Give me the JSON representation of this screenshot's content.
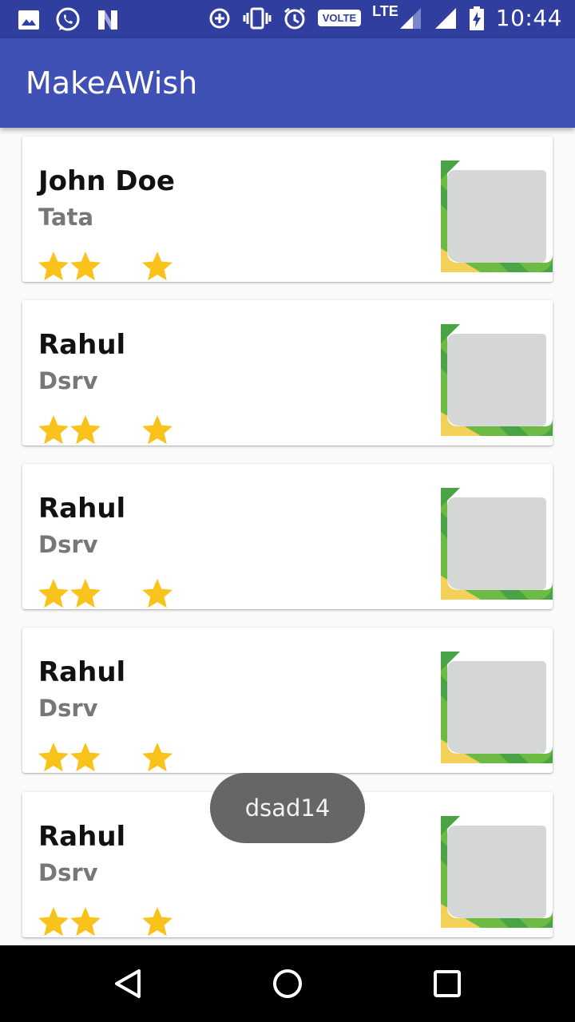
{
  "status_bar": {
    "time": "10:44",
    "volte": "VOLTE",
    "network": "LTE",
    "left_icons": [
      "image-icon",
      "whatsapp-icon",
      "n-logo-icon"
    ],
    "right_icons": [
      "data-saver-icon",
      "vibrate-icon",
      "alarm-icon",
      "volte-icon",
      "signal-icon",
      "signal-icon",
      "battery-charging-icon"
    ]
  },
  "app_bar": {
    "title": "MakeAWish"
  },
  "cards": [
    {
      "name": "John Doe",
      "sub": "Tata",
      "rating": 3
    },
    {
      "name": "Rahul",
      "sub": "Dsrv",
      "rating": 3
    },
    {
      "name": "Rahul",
      "sub": "Dsrv",
      "rating": 3
    },
    {
      "name": "Rahul",
      "sub": "Dsrv",
      "rating": 3
    },
    {
      "name": "Rahul",
      "sub": "Dsrv",
      "rating": 3
    }
  ],
  "toast": {
    "text": "dsad14"
  },
  "nav_bar": {
    "buttons": [
      "back-icon",
      "home-icon",
      "recents-icon"
    ]
  },
  "colors": {
    "status_bar": "#303f9f",
    "app_bar": "#3f51b5",
    "star": "#f9c31b",
    "thumb_green": "#6dbb45",
    "thumb_dark_green": "#4aa446",
    "thumb_yellow": "#f3d159",
    "thumb_gray": "#d5d7d6"
  }
}
